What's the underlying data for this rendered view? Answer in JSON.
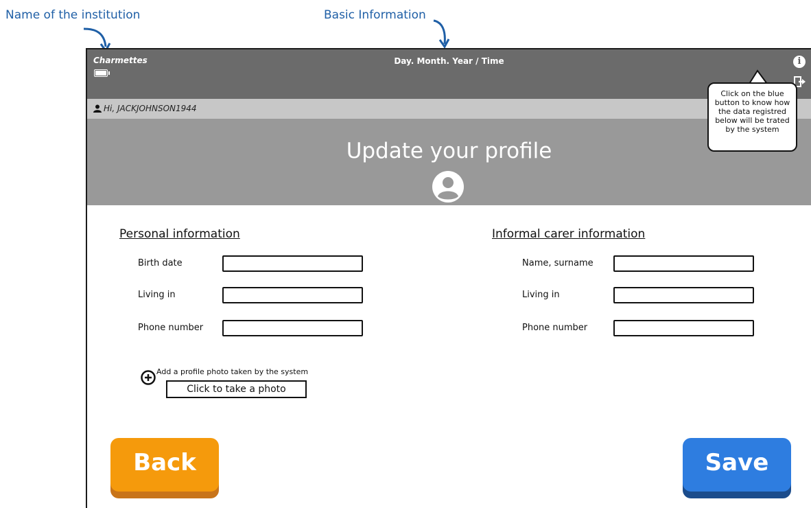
{
  "annotations": {
    "institution_label": "Name of the institution",
    "basic_info_label": "Basic Information"
  },
  "topbar": {
    "institution_name": "Charmettes",
    "datetime": "Day. Month. Year / Time",
    "info_icon": "info-icon",
    "logout_icon": "logout-icon",
    "battery_icon": "battery-icon",
    "battery_level": 0.9
  },
  "greeting": {
    "icon": "user-icon",
    "text": "Hi, JACKJOHNSON1944"
  },
  "header": {
    "title": "Update your profile",
    "avatar_icon": "avatar-icon"
  },
  "personal": {
    "title": "Personal information",
    "fields": [
      {
        "label": "Birth date",
        "value": ""
      },
      {
        "label": "Living in",
        "value": ""
      },
      {
        "label": "Phone number",
        "value": ""
      }
    ]
  },
  "carer": {
    "title": "Informal carer information",
    "fields": [
      {
        "label": "Name, surname",
        "value": ""
      },
      {
        "label": "Living in",
        "value": ""
      },
      {
        "label": "Phone number",
        "value": ""
      }
    ]
  },
  "photo": {
    "add_label": "Add a profile photo taken by the system",
    "button_label": "Click to take a photo",
    "add_icon": "plus-circle-icon"
  },
  "buttons": {
    "back": "Back",
    "save": "Save",
    "back_color": "#f59a0c",
    "save_color": "#2e7de0"
  },
  "tooltip": {
    "text": "Click on the blue button to know how the data registred below will be trated by the system"
  }
}
